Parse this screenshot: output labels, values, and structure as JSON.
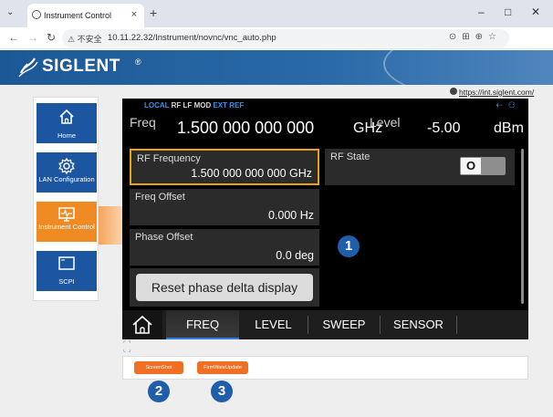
{
  "browser": {
    "tab_title": "Instrument Control",
    "tab_close": "×",
    "new_tab": "+",
    "window_controls": [
      "–",
      "□",
      "✕"
    ],
    "security_label": "⚠ 不安全",
    "url": "10.11.22.32/Instrument/novnc/vnc_auto.php"
  },
  "header": {
    "brand": "SIGLENT",
    "trademark": "®",
    "site_link": "https://int.siglent.com/"
  },
  "nav": {
    "items": [
      {
        "label": "Home",
        "icon": "home-icon"
      },
      {
        "label": "LAN Configuration",
        "icon": "gear-icon"
      },
      {
        "label": "Instrument Control",
        "icon": "waveform-monitor-icon",
        "active": true
      },
      {
        "label": "SCPI",
        "icon": "terminal-icon"
      }
    ]
  },
  "instrument": {
    "status": {
      "local": "LOCAL",
      "rf": "RF",
      "lf": "LF",
      "mod": "MOD",
      "ext_ref": "EXT REF"
    },
    "freq_caption": "Freq",
    "freq_value": "1.500 000 000 000",
    "freq_unit": "GHz",
    "level_caption": "Level",
    "level_value": "-5.00",
    "level_unit": "dBm",
    "fields": {
      "rf_frequency": {
        "label": "RF Frequency",
        "value": "1.500 000 000 000 GHz"
      },
      "rf_state": {
        "label": "RF State",
        "toggle": "O"
      },
      "freq_offset": {
        "label": "Freq Offset",
        "value": "0.000 Hz"
      },
      "phase_offset": {
        "label": "Phase Offset",
        "value": "0.0 deg"
      }
    },
    "reset_button": "Reset phase delta display",
    "tabs": [
      "FREQ",
      "LEVEL",
      "SWEEP",
      "SENSOR"
    ],
    "active_tab": "FREQ"
  },
  "bottom_buttons": {
    "screenshot": "ScreenShot",
    "firmware_update": "FirmWareUpdate"
  },
  "annotations": [
    "1",
    "2",
    "3"
  ],
  "colors": {
    "brand_blue": "#1c5896",
    "nav_blue": "#1c56a0",
    "nav_active_orange": "#f08a22",
    "selected_field_border": "#e7a318",
    "badge_blue": "#1f5ea8",
    "action_button_orange": "#f06f22"
  }
}
